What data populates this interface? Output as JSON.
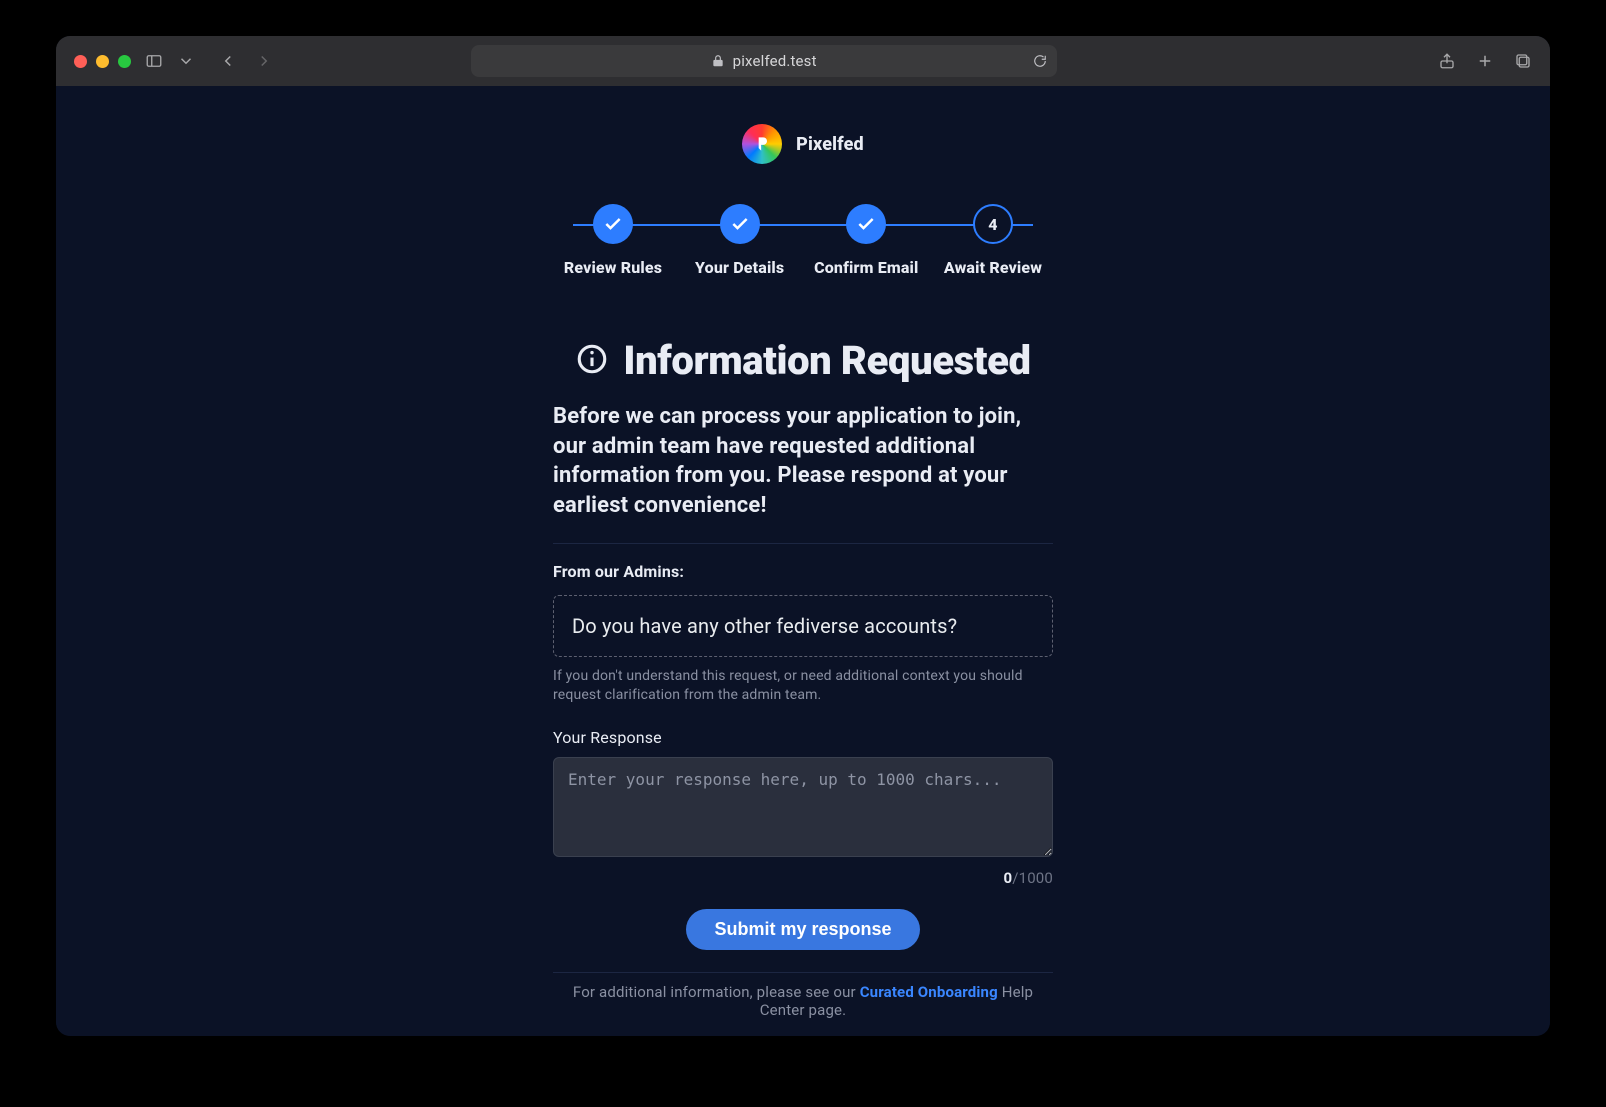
{
  "browser": {
    "url_text": "pixelfed.test"
  },
  "brand": {
    "name": "Pixelfed"
  },
  "stepper": {
    "items": [
      {
        "label": "Review Rules",
        "state": "done"
      },
      {
        "label": "Your Details",
        "state": "done"
      },
      {
        "label": "Confirm Email",
        "state": "done"
      },
      {
        "label": "Await Review",
        "state": "current",
        "number": "4"
      }
    ]
  },
  "heading": "Information Requested",
  "lead": "Before we can process your application to join, our admin team have requested additional information from you. Please respond at your earliest convenience!",
  "admin": {
    "label": "From our Admins:",
    "message": "Do you have any other fediverse accounts?",
    "help": "If you don't understand this request, or need additional context you should request clarification from the admin team."
  },
  "response": {
    "label": "Your Response",
    "placeholder": "Enter your response here, up to 1000 chars...",
    "value": "",
    "counter_current": "0",
    "counter_sep": "/",
    "counter_max": "1000"
  },
  "submit_label": "Submit my response",
  "footer": {
    "prefix": "For additional information, please see our ",
    "link_text": "Curated Onboarding",
    "suffix": " Help Center page."
  }
}
